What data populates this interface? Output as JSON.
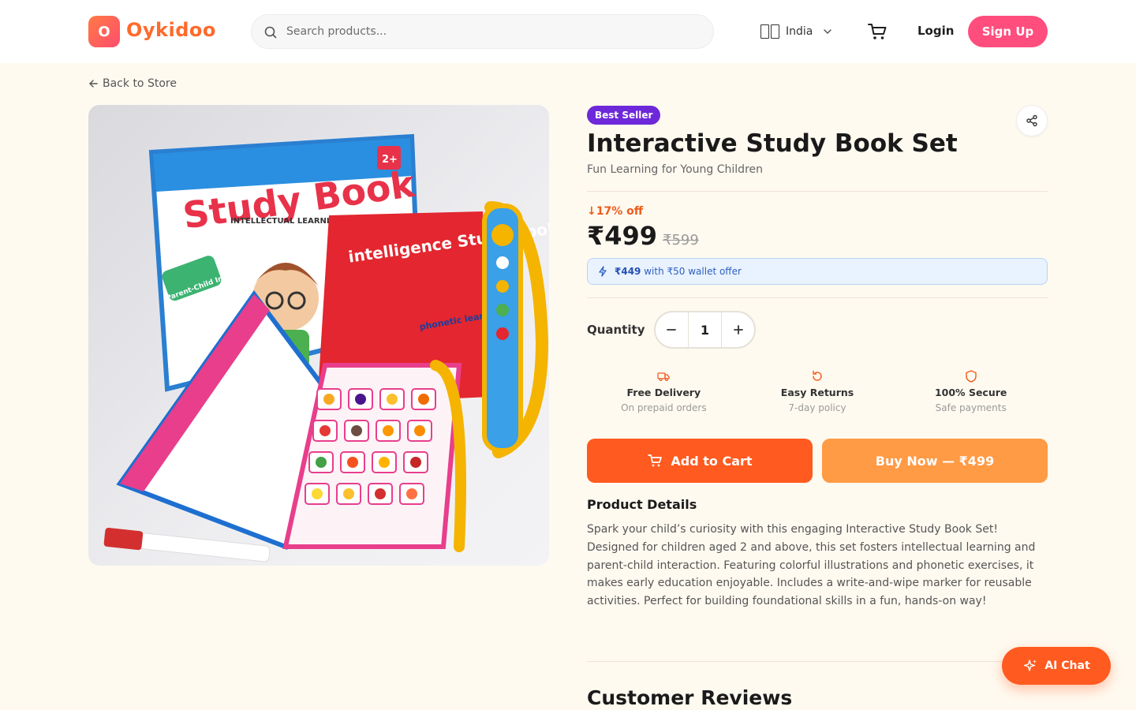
{
  "header": {
    "logo_letter": "O",
    "brand": "Oykidoo",
    "search_placeholder": "Search products...",
    "country": "India",
    "login": "Login",
    "signup": "Sign Up"
  },
  "nav": {
    "back": "Back to Store"
  },
  "product": {
    "badge": "Best Seller",
    "title": "Interactive Study Book Set",
    "subtitle": "Fun Learning for Young Children",
    "discount": "↓17% off",
    "price": "₹499",
    "mrp": "₹599",
    "wallet_price": "₹449",
    "wallet_text": "with ₹50 wallet offer",
    "quantity_label": "Quantity",
    "quantity": "1",
    "image_texts": {
      "box_title": "Study Book",
      "box_sub": "INTELLECTUAL LEARNING",
      "age": "2+",
      "red_book_title": "intelligence Study Book",
      "phonetic": "phonetic learning",
      "parent_child": "Parent-Child Interaction"
    }
  },
  "features": [
    {
      "icon": "truck-icon",
      "title": "Free Delivery",
      "sub": "On prepaid orders"
    },
    {
      "icon": "rotate-icon",
      "title": "Easy Returns",
      "sub": "7-day policy"
    },
    {
      "icon": "shield-icon",
      "title": "100% Secure",
      "sub": "Safe payments"
    }
  ],
  "actions": {
    "add_to_cart": "Add to Cart",
    "buy_now": "Buy Now — ₹499"
  },
  "details": {
    "heading": "Product Details",
    "text": "Spark your child’s curiosity with this engaging Interactive Study Book Set! Designed for children aged 2 and above, this set fosters intellectual learning and parent-child interaction. Featuring colorful illustrations and phonetic exercises, it makes early education enjoyable. Includes a write-and-wipe marker for reusable activities. Perfect for building foundational skills in a fun, hands-on way!"
  },
  "reviews": {
    "heading": "Customer Reviews"
  },
  "ai_chat": "AI Chat",
  "colors": {
    "accent": "#ff5a1f",
    "signup": "#ff4d7e",
    "badge": "#6d28d9",
    "wallet": "#2e5fbf"
  }
}
